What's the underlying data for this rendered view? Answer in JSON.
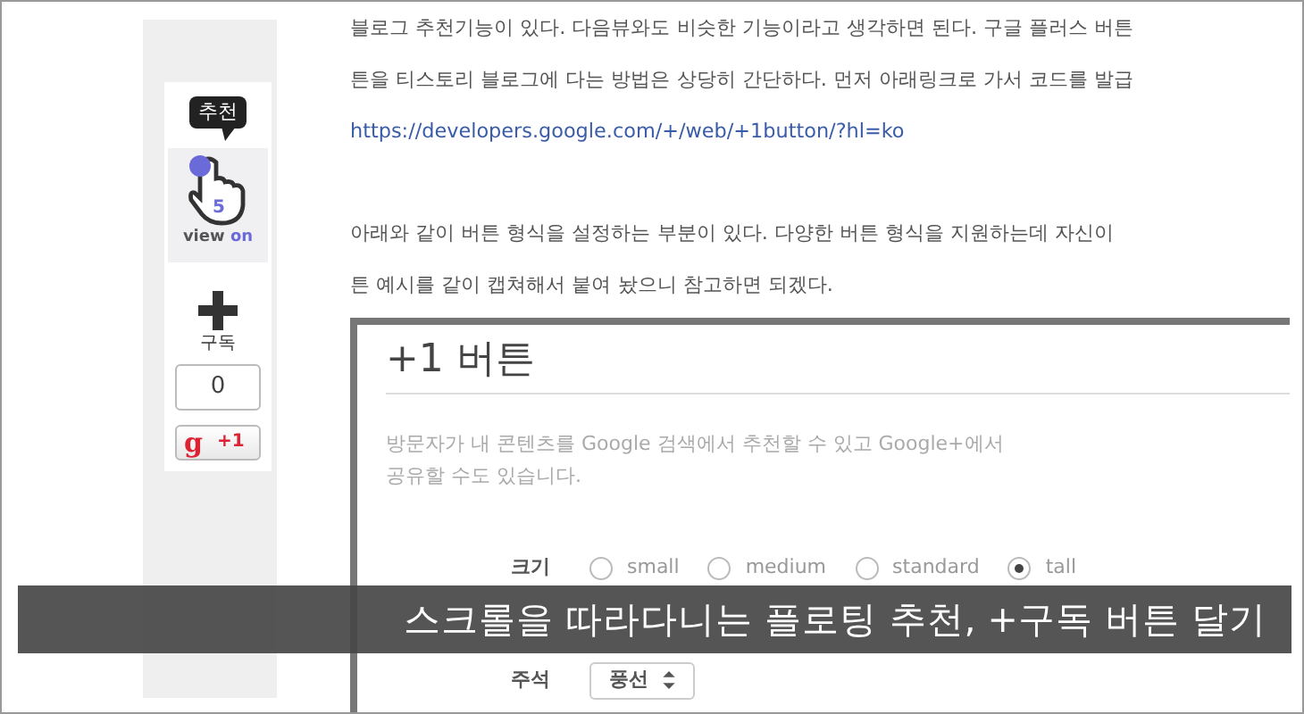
{
  "sidebar": {
    "recommend_label": "추천",
    "recommend_count": "5",
    "view_word": "view",
    "on_word": "on",
    "subscribe_label": "구독",
    "plusone_count": "0",
    "plusone_logo": "g",
    "plusone_button": "+1"
  },
  "article": {
    "paragraphs": [
      {
        "lines": [
          "블로그 추천기능이 있다. 다음뷰와도 비슷한 기능이라고 생각하면 된다. 구글 플러스 버튼",
          "튼을 티스토리 블로그에 다는 방법은 상당히 간단하다. 먼저 아래링크로 가서 코드를 발급"
        ],
        "link": "https://developers.google.com/+/web/+1button/?hl=ko"
      },
      {
        "lines": [
          "아래와 같이 버튼 형식을 설정하는 부분이 있다. 다양한 버튼 형식을 지원하는데 자신이",
          "튼 예시를 같이 캡쳐해서 붙여 놨으니 참고하면 되겠다."
        ]
      }
    ]
  },
  "embedded": {
    "title": "+1 버튼",
    "description": [
      "방문자가 내 콘텐츠를 Google 검색에서 추천할 수 있고 Google+에서",
      "공유할 수도 있습니다."
    ],
    "size_label": "크기",
    "size_options": [
      {
        "label": "small",
        "selected": false
      },
      {
        "label": "medium",
        "selected": false
      },
      {
        "label": "standard",
        "selected": false
      },
      {
        "label": "tall",
        "selected": true
      }
    ],
    "annotation_label": "주석",
    "annotation_value": "풍선"
  },
  "caption": "스크롤을 따라다니는 플로팅 추천, +구독 버튼 달기"
}
